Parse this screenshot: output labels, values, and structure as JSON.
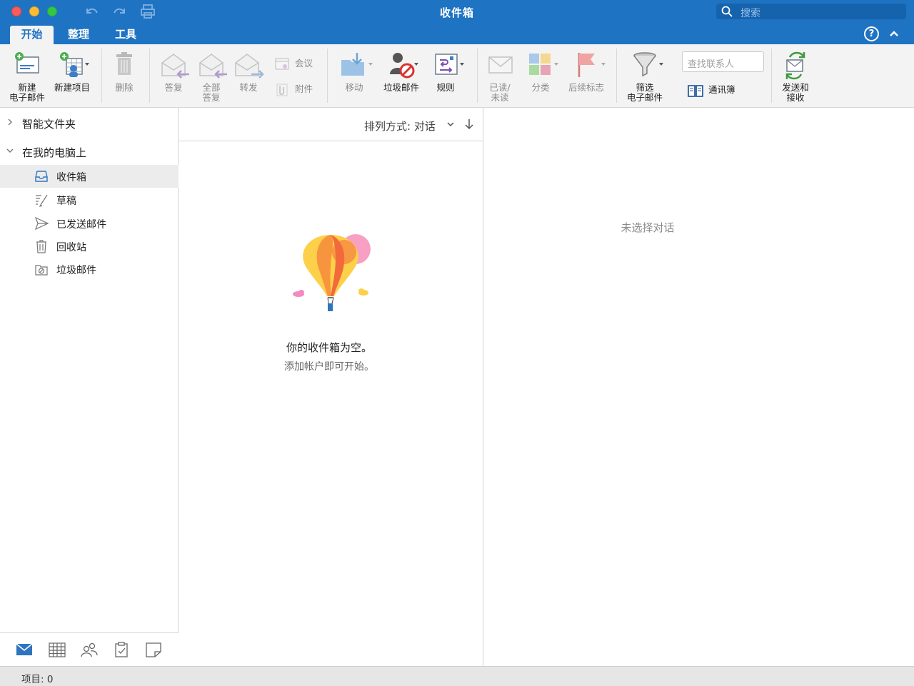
{
  "window": {
    "title": "收件箱",
    "search_placeholder": "搜索"
  },
  "tabs": [
    {
      "label": "开始",
      "active": true
    },
    {
      "label": "整理",
      "active": false
    },
    {
      "label": "工具",
      "active": false
    }
  ],
  "help_label": "?",
  "ribbon": {
    "new_email": "新建\n电子邮件",
    "new_item": "新建项目",
    "delete": "删除",
    "reply": "答复",
    "reply_all": "全部\n答复",
    "forward": "转发",
    "meeting": "会议",
    "attachment": "附件",
    "move": "移动",
    "junk": "垃圾邮件",
    "rules": "规则",
    "read_unread": "已读/\n未读",
    "categorize": "分类",
    "follow_up": "后续标志",
    "filter_email": "筛选\n电子邮件",
    "find_contact_placeholder": "查找联系人",
    "address_book": "通讯簿",
    "send_receive": "发送和\n接收"
  },
  "sidebar": {
    "groups": [
      {
        "label": "智能文件夹",
        "expanded": false
      },
      {
        "label": "在我的电脑上",
        "expanded": true
      }
    ],
    "folders": [
      {
        "label": "收件箱",
        "icon": "inbox-icon",
        "selected": true
      },
      {
        "label": "草稿",
        "icon": "drafts-icon",
        "selected": false
      },
      {
        "label": "已发送邮件",
        "icon": "sent-icon",
        "selected": false
      },
      {
        "label": "回收站",
        "icon": "trash-icon",
        "selected": false
      },
      {
        "label": "垃圾邮件",
        "icon": "junk-folder-icon",
        "selected": false
      }
    ],
    "nav": [
      "mail-icon",
      "calendar-icon",
      "people-icon",
      "tasks-icon",
      "notes-icon"
    ]
  },
  "message_list": {
    "sort_label": "排列方式: 对话",
    "empty_title": "你的收件箱为空。",
    "empty_subtitle": "添加帐户即可开始。"
  },
  "reading_pane": {
    "no_selection": "未选择对话"
  },
  "status": {
    "items": "项目: 0"
  },
  "colors": {
    "accent": "#1f73c3"
  }
}
